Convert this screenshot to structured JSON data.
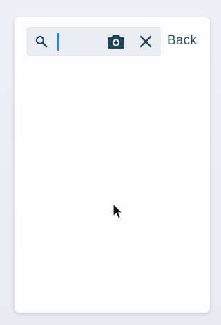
{
  "search": {
    "value": "",
    "placeholder": ""
  },
  "icons": {
    "search": "search-icon",
    "camera": "camera-add-icon",
    "clear": "close-icon",
    "pointer": "mouse-pointer-icon"
  },
  "header": {
    "back_label": "Back"
  },
  "colors": {
    "icon": "#1f4459",
    "caret": "#1a8ad8",
    "search_bg": "#e9ecf1",
    "card_bg": "#fdfdff",
    "page_bg": "#eceef4"
  }
}
